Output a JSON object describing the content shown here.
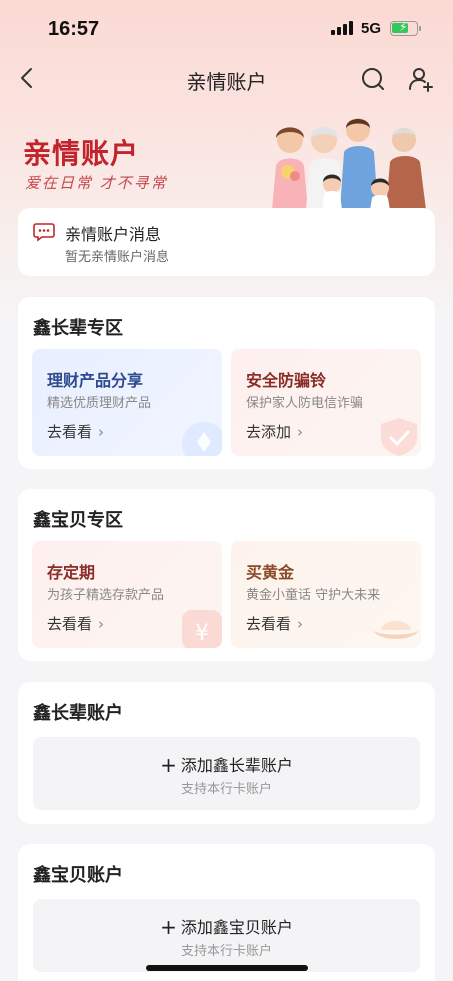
{
  "status_bar": {
    "time": "16:57",
    "network": "5G"
  },
  "nav": {
    "title": "亲情账户"
  },
  "banner": {
    "name": "亲情账户",
    "slogan": "爱在日常 才不寻常"
  },
  "message": {
    "title": "亲情账户消息",
    "subtitle": "暂无亲情账户消息"
  },
  "elder_zone": {
    "title": "鑫长辈专区",
    "tiles": [
      {
        "title": "理财产品分享",
        "subtitle": "精选优质理财产品",
        "link": "去看看"
      },
      {
        "title": "安全防骗铃",
        "subtitle": "保护家人防电信诈骗",
        "link": "去添加"
      }
    ]
  },
  "kid_zone": {
    "title": "鑫宝贝专区",
    "tiles": [
      {
        "title": "存定期",
        "subtitle": "为孩子精选存款产品",
        "link": "去看看"
      },
      {
        "title": "买黄金",
        "subtitle": "黄金小童话 守护大未来",
        "link": "去看看"
      }
    ]
  },
  "elder_account": {
    "title": "鑫长辈账户",
    "add_label": "添加鑫长辈账户",
    "add_sub": "支持本行卡账户"
  },
  "kid_account": {
    "title": "鑫宝贝账户",
    "add_label": "添加鑫宝贝账户",
    "add_sub": "支持本行卡账户"
  },
  "colors": {
    "brand_red": "#c1242a",
    "background": "#f5f5f7"
  }
}
